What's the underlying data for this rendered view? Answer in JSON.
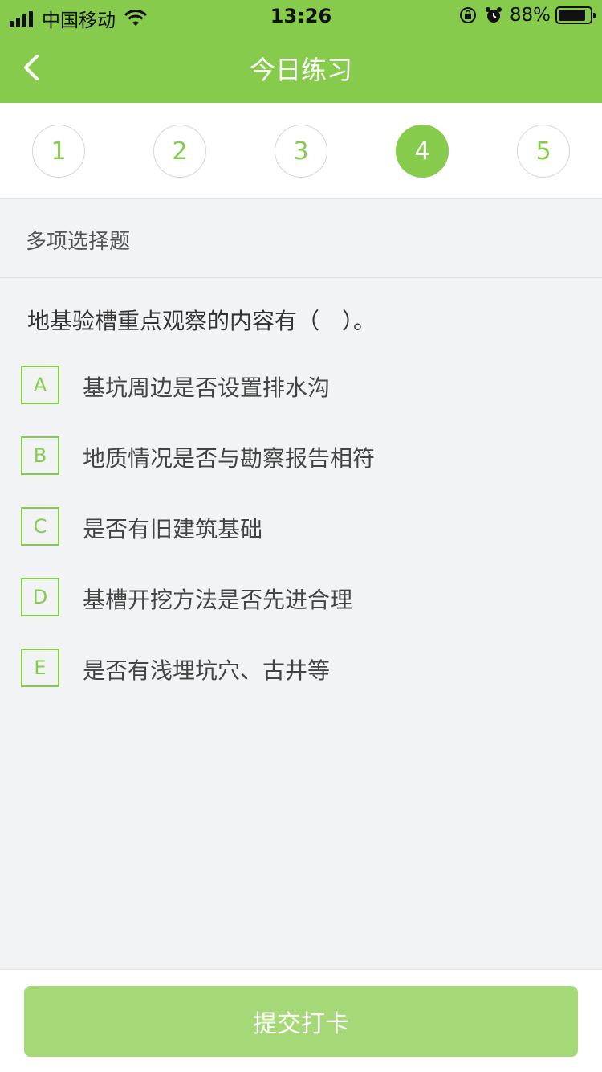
{
  "status_bar": {
    "carrier": "中国移动",
    "time": "13:26",
    "battery_percent": "88%",
    "battery_level": 0.88
  },
  "nav": {
    "title": "今日练习",
    "back_icon": "chevron-left-icon"
  },
  "steps": [
    {
      "label": "1",
      "active": false
    },
    {
      "label": "2",
      "active": false
    },
    {
      "label": "3",
      "active": false
    },
    {
      "label": "4",
      "active": true
    },
    {
      "label": "5",
      "active": false
    }
  ],
  "question": {
    "type": "多项选择题",
    "text": "地基验槽重点观察的内容有（　）。",
    "options": [
      {
        "letter": "A",
        "text": "基坑周边是否设置排水沟"
      },
      {
        "letter": "B",
        "text": "地质情况是否与勘察报告相符"
      },
      {
        "letter": "C",
        "text": "是否有旧建筑基础"
      },
      {
        "letter": "D",
        "text": "基槽开挖方法是否先进合理"
      },
      {
        "letter": "E",
        "text": "是否有浅埋坑穴、古井等"
      }
    ]
  },
  "footer": {
    "submit_label": "提交打卡"
  },
  "colors": {
    "accent": "#86cb4c",
    "submit_bg": "#a5d977",
    "page_bg": "#f2f3f5"
  }
}
